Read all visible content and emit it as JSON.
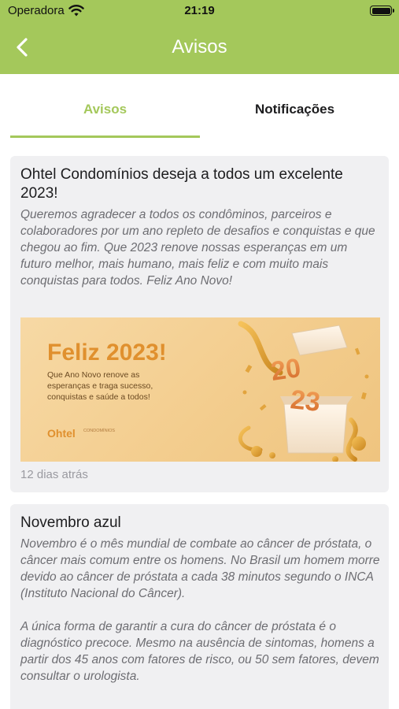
{
  "status": {
    "carrier": "Operadora",
    "time": "21:19"
  },
  "nav": {
    "title": "Avisos",
    "back_icon": "chevron-left-icon"
  },
  "tabs": [
    {
      "label": "Avisos",
      "active": true
    },
    {
      "label": "Notificações",
      "active": false
    }
  ],
  "colors": {
    "accent": "#a4c85b",
    "card_bg": "#f0f0f2",
    "body_text": "#6d6d72"
  },
  "announcements": [
    {
      "title": "Ohtel Condomínios deseja a todos um excelente 2023!",
      "body": "Queremos agradecer a todos os condôminos, parceiros e colaboradores por um ano repleto de desafios e conquistas e que chegou ao fim. Que 2023 renove nossas esperanças em um futuro melhor, mais humano, mais feliz e com muito mais conquistas para todos. Feliz Ano Novo!",
      "banner": {
        "headline": "Feliz 2023!",
        "subtext": "Que Ano Novo renove as\nesperanças e traga sucesso,\nconquistas e saúde a  todos!",
        "logo": "Ohtel",
        "logo_sub": "CONDOMÍNIOS"
      },
      "time": "12 dias atrás"
    },
    {
      "title": "Novembro azul",
      "body": "Novembro é o mês mundial de combate ao câncer de próstata, o câncer mais comum entre os homens. No Brasil um homem morre devido ao câncer de próstata a cada 38 minutos segundo o INCA (Instituto Nacional do Câncer).\n\nA única forma de garantir a cura do câncer de próstata é o diagnóstico precoce. Mesmo na ausência de sintomas, homens a partir dos 45 anos com fatores de risco, ou 50 sem fatores, devem consultar o urologista."
    }
  ]
}
